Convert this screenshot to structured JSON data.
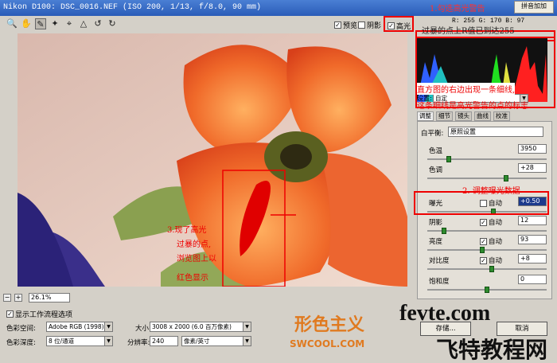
{
  "window": {
    "title": "Nikon D100:  DSC_0016.NEF   (ISO 200, 1/13, f/8.0, 90 mm)",
    "ime_label": "拼音加加"
  },
  "toolbar": {
    "tools": [
      "zoom-icon",
      "hand-icon",
      "eyedropper-icon",
      "color-sampler-icon",
      "crop-icon",
      "straighten-icon",
      "rotate-left-icon",
      "rotate-right-icon"
    ],
    "preview_label": "预览",
    "preview_checked": true,
    "shadow_label": "阴影",
    "shadow_checked": false,
    "highlight_label": "高光",
    "highlight_checked": true
  },
  "preview": {
    "zoom": "26.1%"
  },
  "readout": {
    "text": "R: 255  G: 170  B: 97"
  },
  "annotations": {
    "a1": "1.勾选高光警告",
    "a2": "过暴的点上R值已到达255",
    "a3_line1": "直方图的右边出现一条细线,",
    "a3_line2": "这条细线是高光警告的点的标志",
    "a4": "2. 调整曝光数据",
    "a5_l1": "3.现了高光",
    "a5_l2": "过暴的点,",
    "a5_l3": "浏览图上以",
    "a5_l4": "红色显示"
  },
  "settings": {
    "label": "设置:",
    "value": "自定"
  },
  "tabs": [
    "调整",
    "细节",
    "镜头",
    "曲线",
    "校准"
  ],
  "adjust": {
    "white_balance_label": "白平衡:",
    "white_balance_value": "原照设置",
    "temp_label": "色温",
    "temp_value": "3950",
    "tint_label": "色调",
    "tint_value": "+28",
    "exposure_label": "曝光",
    "exposure_auto": "自动",
    "exposure_value": "+0.50",
    "shadows_label": "阴影",
    "shadows_auto": "自动",
    "shadows_value": "12",
    "brightness_label": "亮度",
    "brightness_auto": "自动",
    "brightness_value": "93",
    "contrast_label": "对比度",
    "contrast_auto": "自动",
    "contrast_value": "+8",
    "saturation_label": "饱和度",
    "saturation_value": "0"
  },
  "workflow": {
    "show_label": "显示工作流程选项",
    "space_label": "色彩空间:",
    "space_value": "Adobe RGB (1998)",
    "depth_label": "色彩深度:",
    "depth_value": "8 位/通道",
    "size_label": "大小:",
    "size_value": "3008 x 2000  (6.0 百万像素)",
    "res_label": "分辨率:",
    "res_value": "240",
    "res_unit": "像素/英寸"
  },
  "buttons": {
    "save": "存储...",
    "cancel": "取消"
  },
  "watermarks": {
    "brand_cn": "形色主义",
    "brand_url": "SWCOOL.COM",
    "site": "fevte.com",
    "site_cn": "飞特教程网"
  }
}
